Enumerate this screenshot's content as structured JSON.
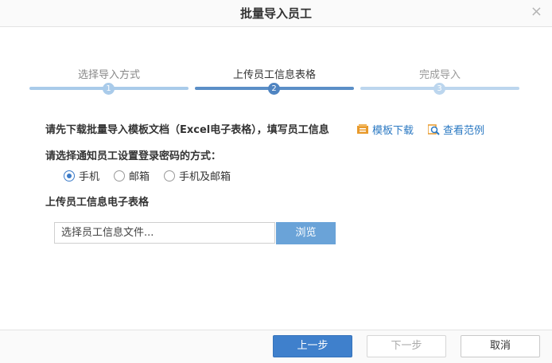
{
  "dialog": {
    "title": "批量导入员工",
    "close_glyph": "×"
  },
  "steps": [
    {
      "label": "选择导入方式",
      "number": "1",
      "state": "done"
    },
    {
      "label": "上传员工信息表格",
      "number": "2",
      "state": "active"
    },
    {
      "label": "完成导入",
      "number": "3",
      "state": "pending"
    }
  ],
  "instruction": "请先下载批量导入模板文档（Excel电子表格），填写员工信息",
  "links": {
    "template_download": "模板下载",
    "view_example": "查看范例"
  },
  "notify": {
    "label": "请选择通知员工设置登录密码的方式：",
    "options": [
      "手机",
      "邮箱",
      "手机及邮箱"
    ],
    "selected": "手机"
  },
  "upload": {
    "label": "上传员工信息电子表格",
    "file_placeholder": "选择员工信息文件...",
    "browse_label": "浏览"
  },
  "footer": {
    "prev_label": "上一步",
    "next_label": "下一步",
    "cancel_label": "取消"
  },
  "colors": {
    "accent": "#3f80cc",
    "step_done": "#a9cbea",
    "step_active": "#5b8fc7",
    "step_pending": "#bcd6ee",
    "link": "#2a78c2"
  }
}
